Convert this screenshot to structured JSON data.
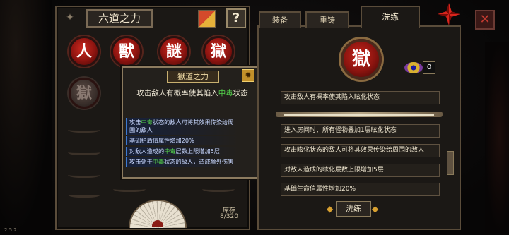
{
  "left_panel": {
    "title": "六道之力",
    "help_label": "?",
    "stock_label": "库存",
    "stock_value": "8/320",
    "orbs": [
      {
        "label": "人",
        "active": true
      },
      {
        "label": "獸",
        "active": true
      },
      {
        "label": "謎",
        "active": true
      },
      {
        "label": "獄",
        "active": true
      },
      {
        "label": "獄",
        "active": false
      }
    ]
  },
  "tooltip": {
    "title": "獄道之力",
    "badge_icon": "gear-icon",
    "desc_before": "攻击敌人有概率使其陷入",
    "desc_highlight": "中毒",
    "desc_after": "状态",
    "lines": [
      {
        "pre": "攻击",
        "hl": "中毒",
        "post": "状态的敌人可将其效果传染给周围的敌人"
      },
      {
        "pre": "基础护盾值属性增加20%",
        "hl": "",
        "post": ""
      },
      {
        "pre": "对敌人造成的",
        "hl": "中毒",
        "post": "层数上限增加5层"
      },
      {
        "pre": "攻击处于",
        "hl": "中毒",
        "post": "状态的敌人，造成额外伤害"
      }
    ]
  },
  "right_panel": {
    "tabs": [
      {
        "label": "装备",
        "active": false
      },
      {
        "label": "重铸",
        "active": false
      },
      {
        "label": "洗练",
        "active": true
      }
    ],
    "big_orb": "獄",
    "eye_count": "0",
    "main_effect": "攻击敌人有概率使其陷入眩化状态",
    "effects": [
      "进入房间时，所有怪物叠加1层眩化状态",
      "攻击眩化状态的敌人可将其效果传染给周围的敌人",
      "对敌人造成的眩化层数上限增加5层",
      "基础生命值属性增加20%"
    ],
    "wash_button": "洗练"
  },
  "close_icon": "close-icon",
  "version": "2.5.2",
  "colors": {
    "highlight_green": "#54d24c",
    "orb_red": "#c8261c",
    "frame": "#5a4c3a"
  }
}
